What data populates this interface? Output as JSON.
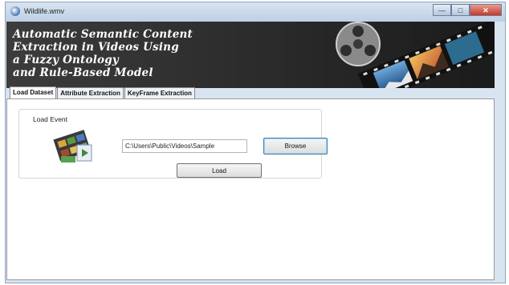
{
  "window": {
    "title": "Wildlife.wmv",
    "min_glyph": "—",
    "max_glyph": "□",
    "close_glyph": "✕"
  },
  "banner": {
    "lines": [
      "Automatic Semantic Content",
      "Extraction in Videos Using",
      "a Fuzzy Ontology",
      "and Rule-Based Model"
    ]
  },
  "tabs": [
    {
      "label": "Load Dataset",
      "active": true
    },
    {
      "label": "Attribute Extraction",
      "active": false
    },
    {
      "label": "KeyFrame Extraction",
      "active": false
    }
  ],
  "load_event": {
    "group_label": "Load Event",
    "path_value": "C:\\Users\\Public\\Videos\\Sample",
    "browse_label": "Browse",
    "load_label": "Load"
  },
  "colors": {
    "titlebar": "#bfd0e6",
    "banner_bg": "#2a2a2a",
    "close_button": "#c4382a",
    "browse_border": "#3c7fb1"
  },
  "icons": [
    "app-icon",
    "film-reel-icon",
    "video-clips-icon"
  ]
}
